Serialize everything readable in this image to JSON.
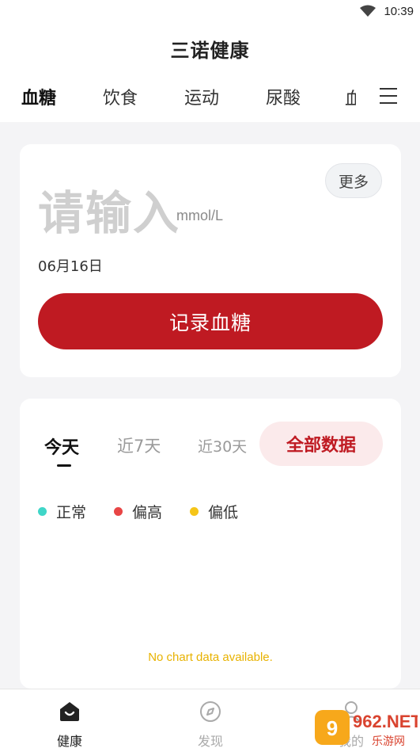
{
  "status_bar": {
    "time": "10:39",
    "wifi_icon": "wifi-icon"
  },
  "header": {
    "title": "三诺健康"
  },
  "tabs": [
    {
      "label": "血糖",
      "active": true
    },
    {
      "label": "饮食",
      "active": false
    },
    {
      "label": "运动",
      "active": false
    },
    {
      "label": "尿酸",
      "active": false
    },
    {
      "label": "血",
      "active": false
    }
  ],
  "menu_icon": "hamburger-menu-icon",
  "input_card": {
    "more_label": "更多",
    "placeholder": "请输入",
    "unit": "mmol/L",
    "date": "06月16日",
    "record_button": "记录血糖"
  },
  "data_card": {
    "ranges": [
      "今天",
      "近7天",
      "近30天"
    ],
    "all_data_label": "全部数据",
    "legend": [
      {
        "label": "正常",
        "color": "#3fd6c8"
      },
      {
        "label": "偏高",
        "color": "#e84545"
      },
      {
        "label": "偏低",
        "color": "#f5c518"
      }
    ],
    "no_data_text": "No chart data available."
  },
  "bottom_nav": [
    {
      "label": "健康",
      "icon": "smile-home-icon",
      "active": true
    },
    {
      "label": "发现",
      "icon": "compass-icon",
      "active": false
    },
    {
      "label": "我的",
      "icon": "person-icon",
      "active": false
    }
  ],
  "watermark": {
    "text": "962.NET",
    "subtext": "乐游网"
  },
  "colors": {
    "accent": "#bf1a22",
    "accent_soft": "#fbeaeb",
    "background": "#f4f4f6"
  }
}
